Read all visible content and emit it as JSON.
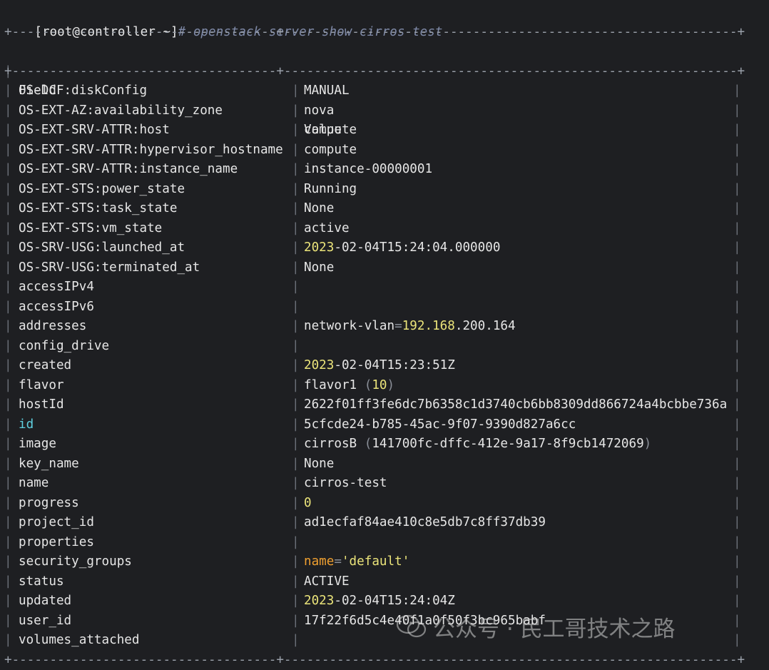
{
  "prompt": {
    "user_host": "[root@controller ~]",
    "command": "# openstack server show cirros-test"
  },
  "table": {
    "border_line": "+-----------------------------------+------------------------------------------------------------+",
    "headers": {
      "field": "Field",
      "value": "Value"
    },
    "rows": [
      {
        "field": "OS-DCF:diskConfig",
        "value": "MANUAL"
      },
      {
        "field": "OS-EXT-AZ:availability_zone",
        "value": "nova"
      },
      {
        "field": "OS-EXT-SRV-ATTR:host",
        "value": "compute"
      },
      {
        "field": "OS-EXT-SRV-ATTR:hypervisor_hostname",
        "value": "compute"
      },
      {
        "field": "OS-EXT-SRV-ATTR:instance_name",
        "value": "instance-00000001"
      },
      {
        "field": "OS-EXT-STS:power_state",
        "value": "Running"
      },
      {
        "field": "OS-EXT-STS:task_state",
        "value": "None"
      },
      {
        "field": "OS-EXT-STS:vm_state",
        "value": "active"
      },
      {
        "field": "OS-SRV-USG:launched_at",
        "value_year": "2023",
        "value_rest": "-02-04T15:24:04.000000"
      },
      {
        "field": "OS-SRV-USG:terminated_at",
        "value": "None"
      },
      {
        "field": "accessIPv4",
        "value": ""
      },
      {
        "field": "accessIPv6",
        "value": ""
      },
      {
        "field": "addresses",
        "value_key": "network-vlan",
        "value_eq": "=",
        "ip_a": "192",
        "ip_dot1": ".",
        "ip_b": "168",
        "ip_rest": ".200.164"
      },
      {
        "field": "config_drive",
        "value": ""
      },
      {
        "field": "created",
        "value_year": "2023",
        "value_rest": "-02-04T15:23:51Z"
      },
      {
        "field": "flavor",
        "value_name": "flavor1 ",
        "value_open": "(",
        "value_num": "10",
        "value_close": ")"
      },
      {
        "field": "hostId",
        "value": "2622f01ff3fe6dc7b6358c1d3740cb6bb8309dd866724a4bcbbe736a"
      },
      {
        "field": "id",
        "value": "5cfcde24-b785-45ac-9f07-9390d827a6cc"
      },
      {
        "field": "image",
        "value_name": "cirrosB ",
        "value_open": "(",
        "value_inner": "141700fc-dffc-412e-9a17-8f9cb1472069",
        "value_close": ")"
      },
      {
        "field": "key_name",
        "value": "None"
      },
      {
        "field": "name",
        "value": "cirros-test"
      },
      {
        "field": "progress",
        "value": "0"
      },
      {
        "field": "project_id",
        "value": "ad1ecfaf84ae410c8e5db7c8ff37db39"
      },
      {
        "field": "properties",
        "value": ""
      },
      {
        "field": "security_groups",
        "value_key": "name",
        "value_eq": "=",
        "value_str": "'default'"
      },
      {
        "field": "status",
        "value": "ACTIVE"
      },
      {
        "field": "updated",
        "value_year": "2023",
        "value_rest": "-02-04T15:24:04Z"
      },
      {
        "field": "user_id",
        "value": "17f22f6d5c4e40f1a0f50f3bc965babf"
      },
      {
        "field": "volumes_attached",
        "value": ""
      }
    ]
  },
  "watermark": {
    "text": "公众号 · 民工哥技术之路"
  },
  "colors": {
    "background": "#1e1f22",
    "text": "#e6e6e6",
    "number_yellow": "#ebe47a",
    "key_orange": "#f0a030",
    "field_cyan": "#5fcfdf",
    "command_gray": "#7f8aa8"
  }
}
